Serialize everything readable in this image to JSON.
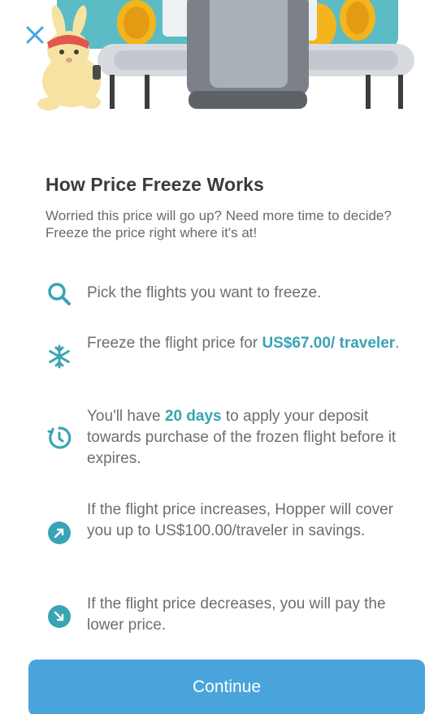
{
  "header": {
    "title": "How Price Freeze Works",
    "subtitle": "Worried this price will go up? Need more time to decide? Freeze the price right where it's at!"
  },
  "steps": [
    {
      "icon": "search-icon",
      "text": "Pick the flights you want to freeze."
    },
    {
      "icon": "snowflake-icon",
      "pre": "Freeze the flight price for ",
      "highlight": "US$67.00/ traveler",
      "post": "."
    },
    {
      "icon": "timer-icon",
      "pre": "You'll have ",
      "highlight": "20 days",
      "post": " to apply your deposit towards purchase of the frozen flight before it expires."
    },
    {
      "icon": "arrow-up-right-icon",
      "text": "If the flight price increases, Hopper will cover you up to US$100.00/traveler in savings."
    },
    {
      "icon": "arrow-down-right-icon",
      "text": "If the flight price decreases, you will pay the lower price."
    }
  ],
  "actions": {
    "continue_label": "Continue"
  },
  "colors": {
    "accent": "#3aa3b5",
    "button": "#4aa4dc"
  }
}
